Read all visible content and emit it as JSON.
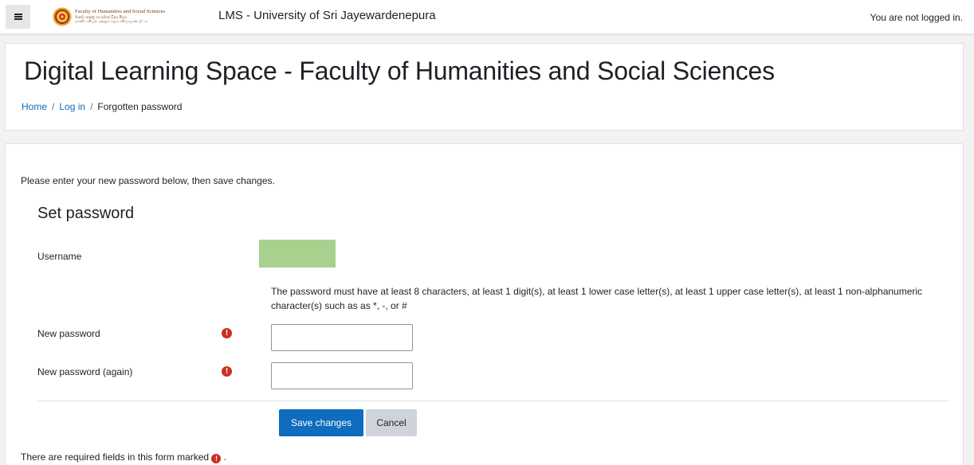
{
  "navbar": {
    "brand_line1": "Faculty of Humanities and Social Sciences",
    "brand_line2": "මානව ශාස්ත්‍ර හා සමාජ විද්‍යා පීඨය",
    "brand_line3": "மானிடவியல் மற்றும் சமூக விஞ்ஞான பீடம்",
    "site_name": "LMS - University of Sri Jayewardenepura",
    "login_status": "You are not logged in."
  },
  "header": {
    "title": "Digital Learning Space - Faculty of Humanities and Social Sciences",
    "breadcrumb": [
      {
        "label": "Home"
      },
      {
        "label": "Log in"
      },
      {
        "label": "Forgotten password"
      }
    ],
    "separator": "/"
  },
  "form": {
    "instructions": "Please enter your new password below, then save changes.",
    "legend": "Set password",
    "username_label": "Username",
    "password_rules": "The password must have at least 8 characters, at least 1 digit(s), at least 1 lower case letter(s), at least 1 upper case letter(s), at least 1 non-alphanumeric character(s) such as as *, -, or #",
    "new_password_label": "New password",
    "new_password_value": "",
    "new_password_again_label": "New password (again)",
    "new_password_again_value": "",
    "save_label": "Save changes",
    "cancel_label": "Cancel",
    "required_note_prefix": "There are required fields in this form marked",
    "required_note_suffix": ".",
    "required_glyph": "!"
  },
  "colors": {
    "accent": "#0f6cbf",
    "required": "#ca3120",
    "redacted": "#a9d18e",
    "secondary_button": "#ced4da"
  },
  "icons": {
    "menu": "hamburger-icon",
    "required": "exclamation-circle-icon",
    "logo": "university-seal-icon"
  }
}
